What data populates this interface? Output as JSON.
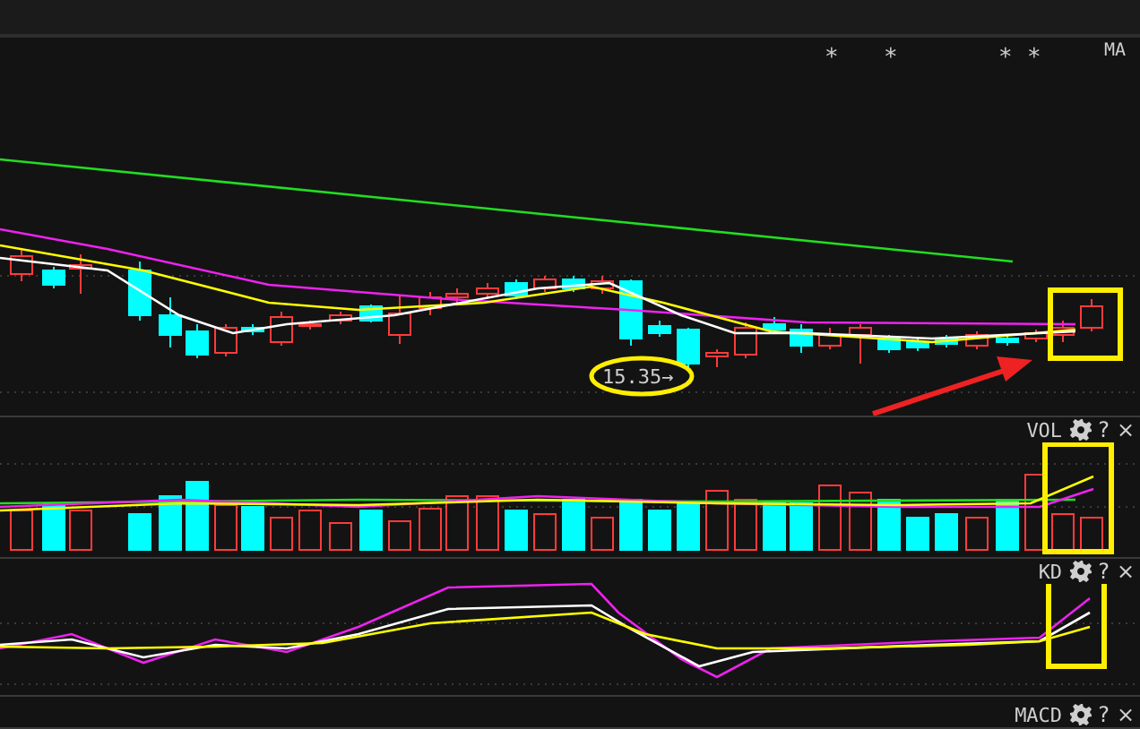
{
  "main_panel": {
    "indicator": "MA",
    "marks": [
      "*",
      "*",
      "*",
      "*"
    ],
    "price_label": "15.35→"
  },
  "panels": [
    {
      "name": "VOL",
      "help": "?",
      "close": "×"
    },
    {
      "name": "KD",
      "help": "?",
      "close": "×"
    },
    {
      "name": "MACD",
      "help": "?",
      "close": "×"
    }
  ]
}
